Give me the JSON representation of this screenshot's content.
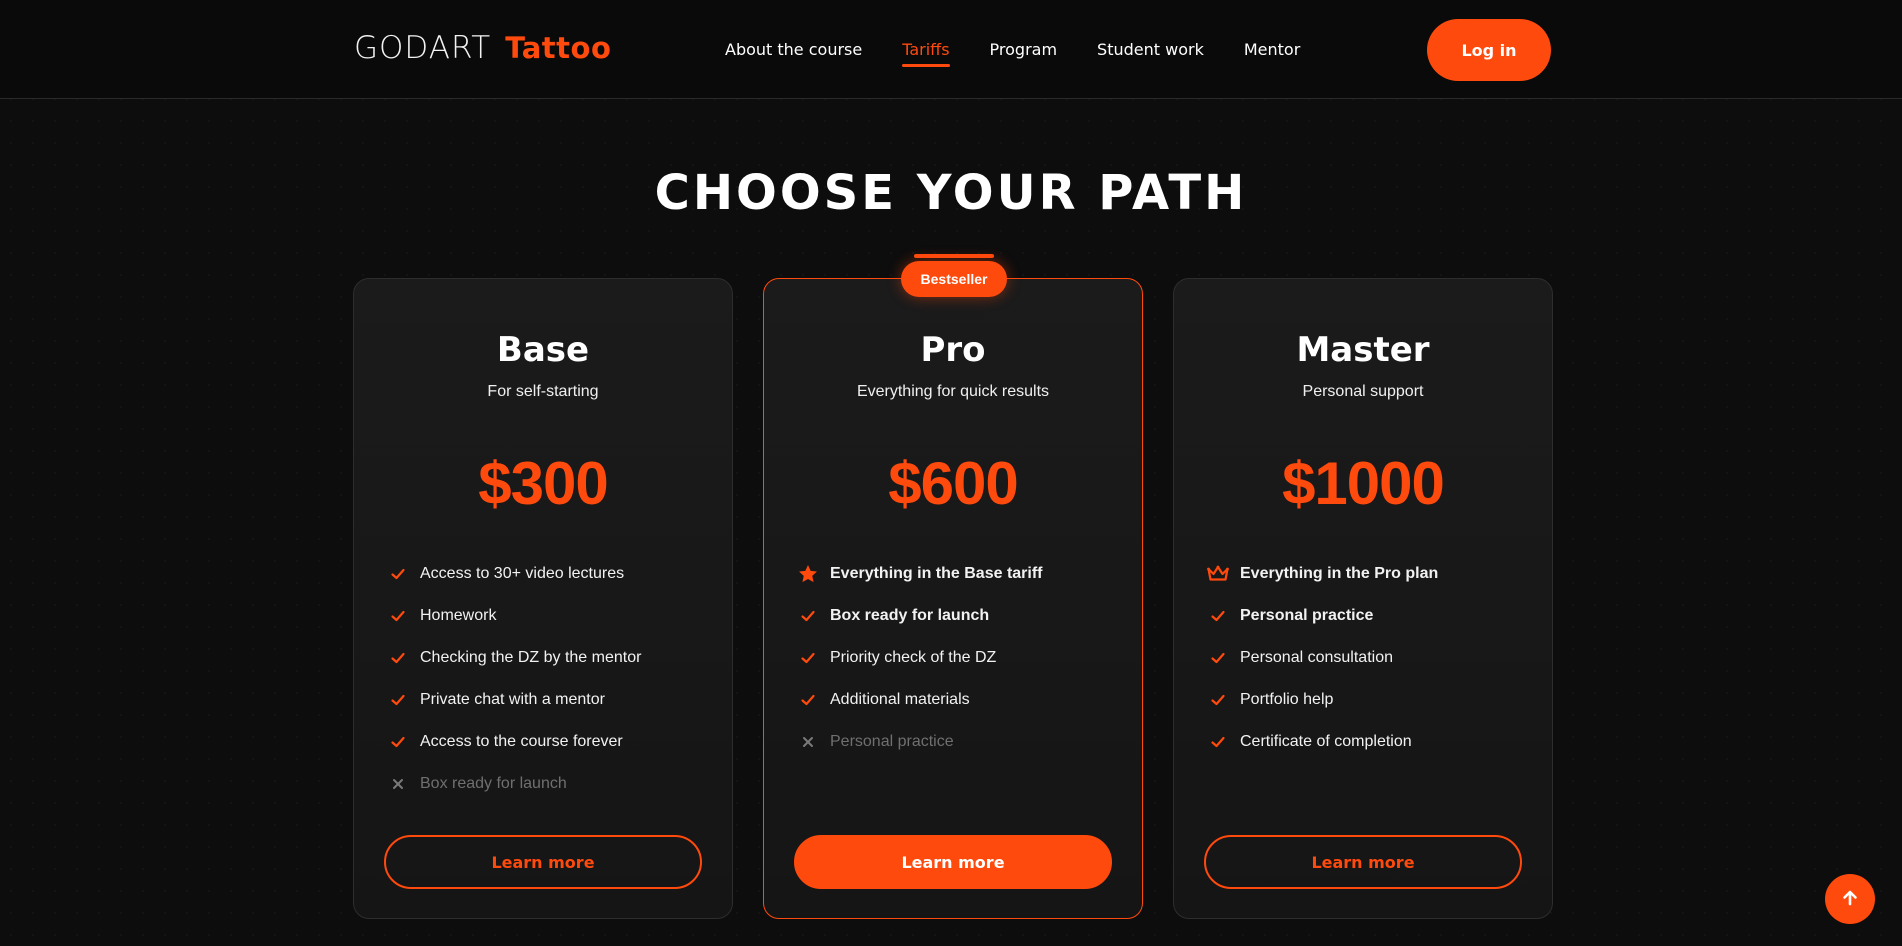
{
  "header": {
    "logo_main": "GODART",
    "logo_sub": "Tattoo",
    "nav": [
      {
        "label": "About the course",
        "active": false
      },
      {
        "label": "Tariffs",
        "active": true
      },
      {
        "label": "Program",
        "active": false
      },
      {
        "label": "Student work",
        "active": false
      },
      {
        "label": "Mentor",
        "active": false
      }
    ],
    "login_label": "Log in"
  },
  "section": {
    "title": "CHOOSE YOUR PATH"
  },
  "plans": [
    {
      "name": "Base",
      "subtitle": "For self-starting",
      "price": "$300",
      "features": [
        {
          "text": "Access to 30+ video lectures",
          "icon": "check-icon",
          "bold": false,
          "included": true
        },
        {
          "text": "Homework",
          "icon": "check-icon",
          "bold": false,
          "included": true
        },
        {
          "text": "Checking the DZ by the mentor",
          "icon": "check-icon",
          "bold": false,
          "included": true
        },
        {
          "text": "Private chat with a mentor",
          "icon": "check-icon",
          "bold": false,
          "included": true
        },
        {
          "text": "Access to the course forever",
          "icon": "check-icon",
          "bold": false,
          "included": true
        },
        {
          "text": "Box ready for launch",
          "icon": "cross-icon",
          "bold": false,
          "included": false
        }
      ],
      "button_label": "Learn more"
    },
    {
      "name": "Pro",
      "subtitle": "Everything for quick results",
      "price": "$600",
      "badge": "Bestseller",
      "features": [
        {
          "text": "Everything in the Base tariff",
          "icon": "star-icon",
          "bold": true,
          "included": true
        },
        {
          "text": "Box ready for launch",
          "icon": "check-icon",
          "bold": true,
          "included": true
        },
        {
          "text": "Priority check of the DZ",
          "icon": "check-icon",
          "bold": false,
          "included": true
        },
        {
          "text": "Additional materials",
          "icon": "check-icon",
          "bold": false,
          "included": true
        },
        {
          "text": "Personal practice",
          "icon": "cross-icon",
          "bold": false,
          "included": false
        }
      ],
      "button_label": "Learn more"
    },
    {
      "name": "Master",
      "subtitle": "Personal support",
      "price": "$1000",
      "features": [
        {
          "text": "Everything in the Pro plan",
          "icon": "crown-icon",
          "bold": true,
          "included": true
        },
        {
          "text": "Personal practice",
          "icon": "check-icon",
          "bold": true,
          "included": true
        },
        {
          "text": "Personal consultation",
          "icon": "check-icon",
          "bold": false,
          "included": true
        },
        {
          "text": "Portfolio help",
          "icon": "check-icon",
          "bold": false,
          "included": true
        },
        {
          "text": "Certificate of completion",
          "icon": "check-icon",
          "bold": false,
          "included": true
        }
      ],
      "button_label": "Learn more"
    }
  ],
  "scroll_top_icon": "arrow-up-icon",
  "colors": {
    "accent": "#ff4a0d",
    "background": "#0d0d0d",
    "card": "#1b1b1b",
    "muted": "#6f6f6f"
  }
}
